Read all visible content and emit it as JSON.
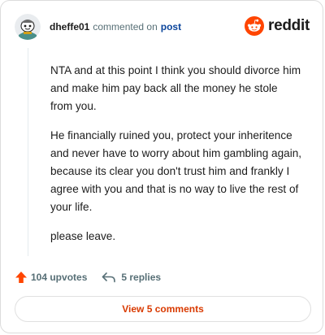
{
  "header": {
    "username": "dheffe01",
    "commented_text": "commented on",
    "post_link": "post"
  },
  "brand": {
    "name": "reddit",
    "color": "#ff4500"
  },
  "comment": {
    "paragraphs": [
      "NTA and at this point I think you should divorce him and make him pay back all the money he stole from you.",
      "He financially ruined you, protect your inheritence and never have to worry about him gambling again, because its clear you don't trust him and frankly I agree with you and that is no way to live the rest of your life.",
      "please leave."
    ]
  },
  "actions": {
    "upvotes": "104 upvotes",
    "replies": "5 replies",
    "upvote_color": "#ff4500"
  },
  "footer": {
    "view_comments": "View 5 comments",
    "accent": "#d93a00"
  }
}
